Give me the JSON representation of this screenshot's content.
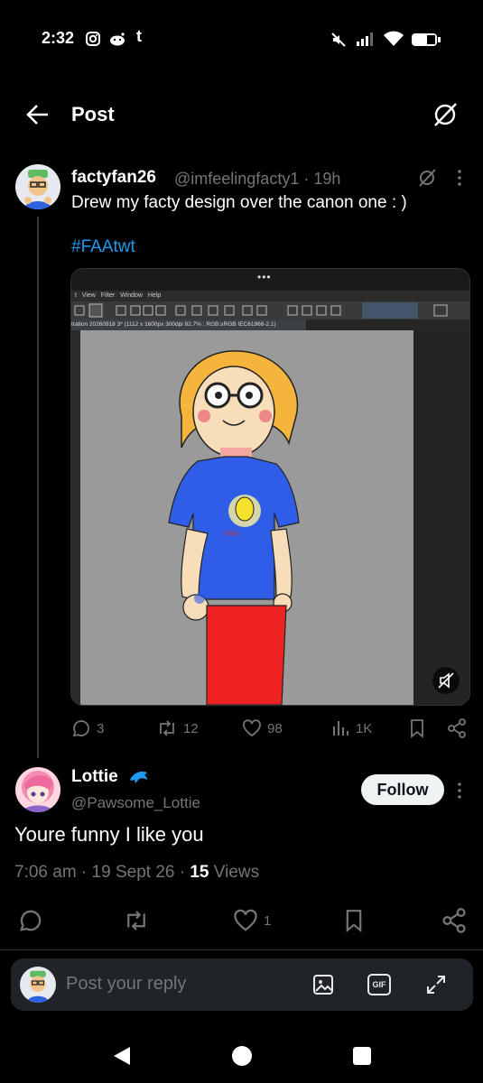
{
  "status_bar": {
    "time": "2:32"
  },
  "header": {
    "title": "Post"
  },
  "tweet": {
    "author_name": "factyfan26",
    "handle_time": "@imfeelingfacty1 · 19h",
    "text": "Drew my facty design over the canon one : )",
    "hashtag": "#FAAtwt",
    "image": {
      "menu": [
        "t",
        "View",
        "Filter",
        "Window",
        "Help"
      ],
      "doc_tab": "tration 20260918 3* (1112 x 1600px 300dpi 82.7% : RGB:sRGB IEC61966-2.1)",
      "more": "•••"
    },
    "actions": {
      "replies": "3",
      "reposts": "12",
      "likes": "98",
      "views": "1K"
    }
  },
  "reply": {
    "name": "Lottie",
    "handle": "@Pawsome_Lottie",
    "follow_label": "Follow",
    "text": "Youre funny I like you",
    "meta_time": "7:06 am · 19 Sept 26 · ",
    "views_count": "15",
    "views_label": " Views",
    "likes": "1"
  },
  "composer": {
    "placeholder": "Post your reply",
    "gif_label": "GIF"
  },
  "colors": {
    "accent": "#1d9bf0",
    "background": "#000000",
    "muted": "#71767b"
  }
}
